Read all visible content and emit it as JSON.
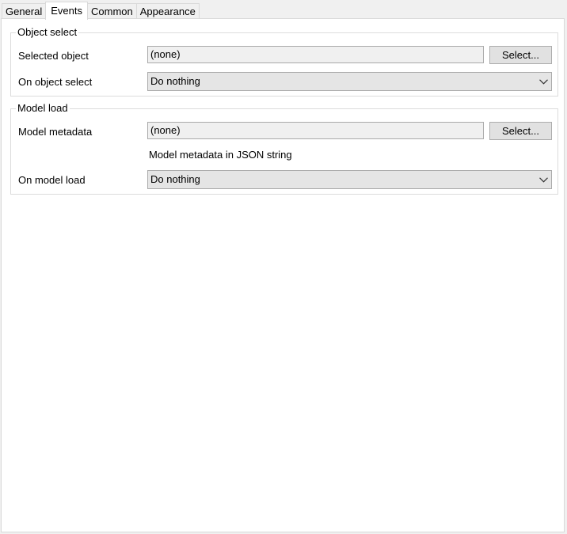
{
  "tabs": [
    {
      "label": "General",
      "active": false
    },
    {
      "label": "Events",
      "active": true
    },
    {
      "label": "Common",
      "active": false
    },
    {
      "label": "Appearance",
      "active": false
    }
  ],
  "object_select": {
    "title": "Object select",
    "selected_object_label": "Selected object",
    "selected_object_value": "(none)",
    "select_button": "Select...",
    "on_select_label": "On object select",
    "on_select_value": "Do nothing"
  },
  "model_load": {
    "title": "Model load",
    "metadata_label": "Model metadata",
    "metadata_value": "(none)",
    "select_button": "Select...",
    "metadata_hint": "Model metadata in JSON string",
    "on_load_label": "On model load",
    "on_load_value": "Do nothing"
  },
  "icons": {
    "dropdown": "chevron-down-icon"
  }
}
